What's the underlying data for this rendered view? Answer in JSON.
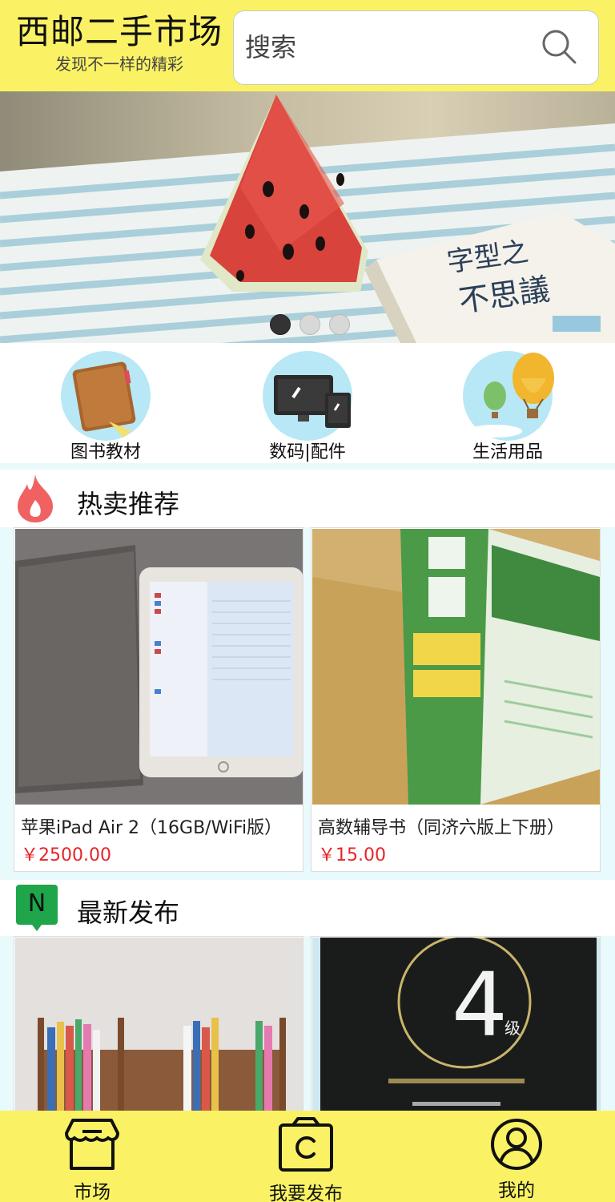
{
  "header": {
    "brand_title": "西邮二手市场",
    "brand_subtitle": "发现不一样的精彩",
    "search_placeholder": "搜索"
  },
  "banner": {
    "book_text_line1": "字型之",
    "book_text_line2": "不思議",
    "slide_count": 3,
    "active_slide": 1
  },
  "categories": [
    {
      "label": "图书教材",
      "icon": "book-icon"
    },
    {
      "label": "数码|配件",
      "icon": "devices-icon"
    },
    {
      "label": "生活用品",
      "icon": "balloon-icon"
    }
  ],
  "hot": {
    "title": "热卖推荐",
    "icon": "flame-icon",
    "items": [
      {
        "title": "苹果iPad Air 2（16GB/WiFi版）",
        "price": "￥2500.00"
      },
      {
        "title": "高数辅导书（同济六版上下册）",
        "price": "￥15.00"
      }
    ]
  },
  "latest": {
    "title": "最新发布",
    "badge": "N"
  },
  "nav": {
    "market": "市场",
    "publish": "我要发布",
    "mine": "我的"
  },
  "colors": {
    "accent_yellow": "#faf264",
    "price_red": "#e8242a",
    "background": "#e9fafc",
    "new_badge_green": "#1fa54a"
  }
}
